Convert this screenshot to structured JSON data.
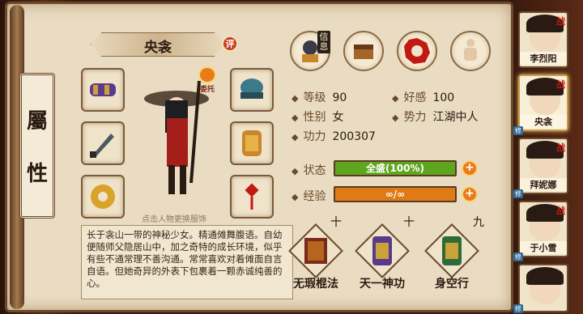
{
  "panel": {
    "title_chars": [
      "屬",
      "性"
    ]
  },
  "character": {
    "name": "央衾",
    "eval_label": "评",
    "swap_label": "委托",
    "hint": "点击人物更换服饰",
    "description": "长于衾山一带的神秘少女。精通傩舞腹语。自幼便随师父隐居山中，加之奇特的成长环境，似乎有些不通常理不善沟通。常常喜欢对着傩面自言自语。但她奇异的外表下包裹着一颗赤诚纯善的心。"
  },
  "tabs": {
    "active_label": "信息",
    "items": [
      {
        "name": "info-tab-icon",
        "label": "信息"
      },
      {
        "name": "treasure-tab-icon",
        "label": ""
      },
      {
        "name": "bagua-tab-icon",
        "label": ""
      },
      {
        "name": "body-tab-icon",
        "label": ""
      }
    ]
  },
  "stats": {
    "level_label": "等级",
    "level": "90",
    "favor_label": "好感",
    "favor": "100",
    "gender_label": "性别",
    "gender": "女",
    "faction_label": "势力",
    "faction": "江湖中人",
    "power_label": "功力",
    "power": "200307",
    "status_label": "状态",
    "status_value": "全盛(100%)",
    "status_fraction": 1.0,
    "exp_label": "经验",
    "exp_value": "∞/∞",
    "exp_fraction": 1.0,
    "plus": "+"
  },
  "skills": [
    {
      "name": "无瑕棍法",
      "level": "十"
    },
    {
      "name": "天一神功",
      "level": "十"
    },
    {
      "name": "身空行",
      "level": "九"
    }
  ],
  "roster": [
    {
      "name": "李烈阳",
      "badge": "战",
      "mark": ""
    },
    {
      "name": "央衾",
      "badge": "战",
      "mark": "修"
    },
    {
      "name": "拜妮娜",
      "badge": "战",
      "mark": "修"
    },
    {
      "name": "于小雪",
      "badge": "战",
      "mark": "修"
    },
    {
      "name": "",
      "badge": "",
      "mark": "修"
    }
  ],
  "colors": {
    "status_bar": "#5fa61f",
    "exp_bar": "#e07a14",
    "accent": "#c01a12"
  }
}
